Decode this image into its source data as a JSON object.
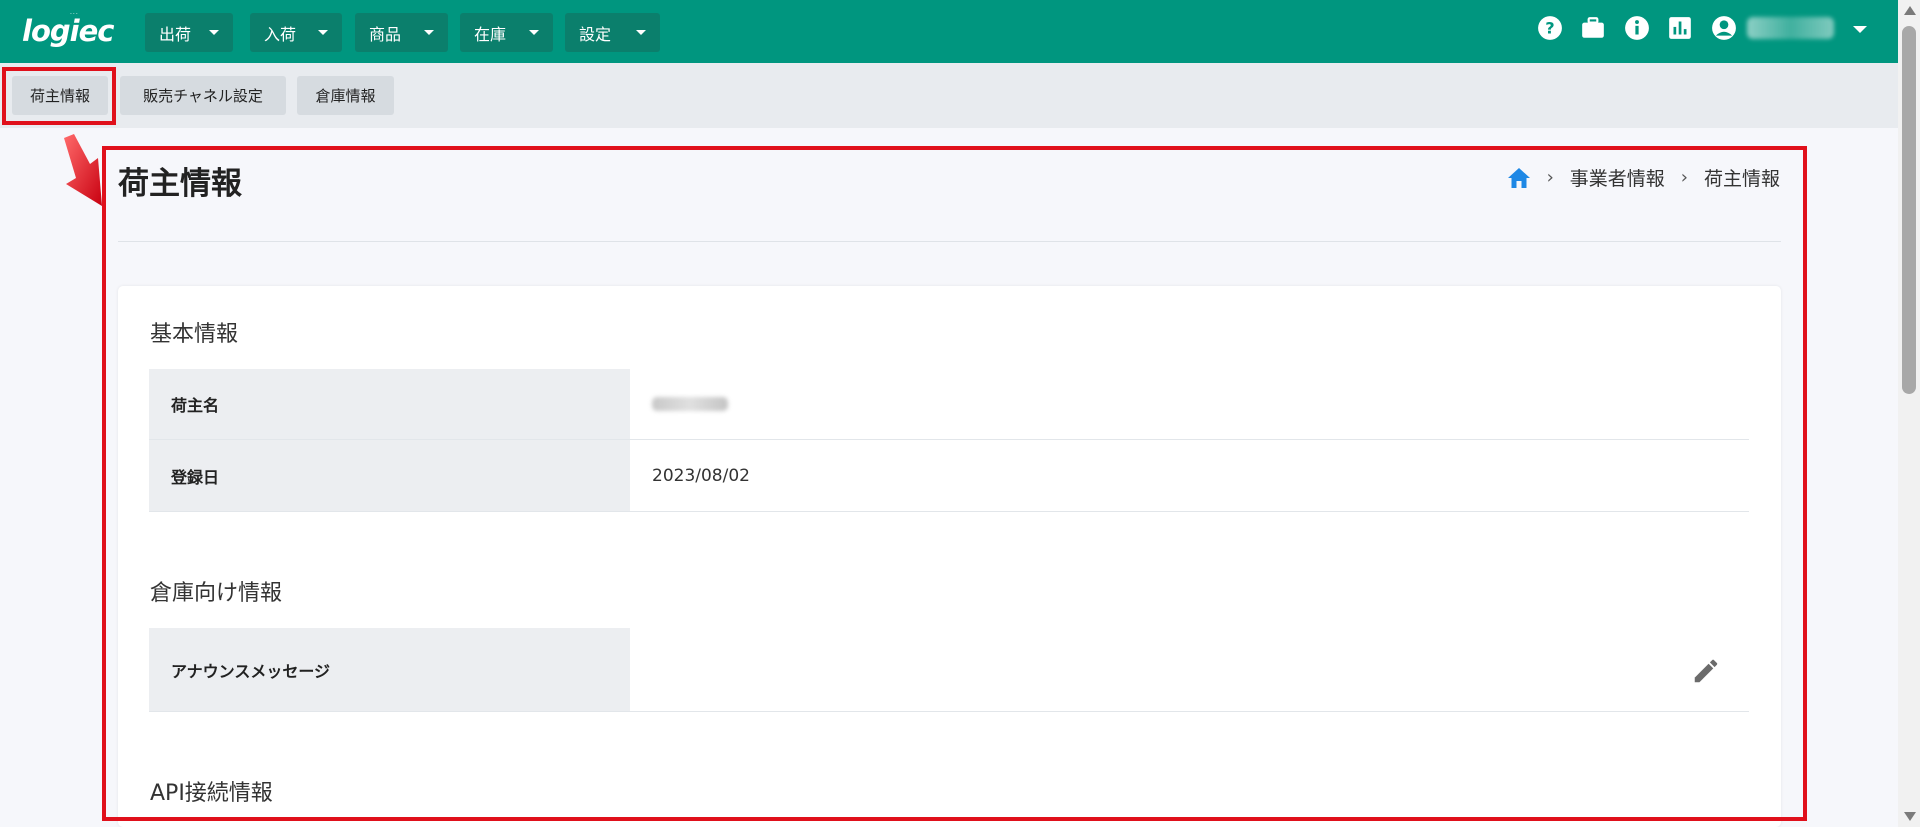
{
  "app": {
    "logo": "logiec"
  },
  "topnav": {
    "menus": [
      {
        "label": "出荷"
      },
      {
        "label": "入荷"
      },
      {
        "label": "商品"
      },
      {
        "label": "在庫"
      },
      {
        "label": "設定"
      }
    ],
    "icons": [
      "help-icon",
      "briefcase-icon",
      "info-icon",
      "bar-chart-icon",
      "account-icon"
    ]
  },
  "subnav": {
    "tabs": [
      {
        "label": "荷主情報"
      },
      {
        "label": "販売チャネル設定"
      },
      {
        "label": "倉庫情報"
      }
    ]
  },
  "page": {
    "title": "荷主情報",
    "breadcrumb": [
      "事業者情報",
      "荷主情報"
    ]
  },
  "basic_info": {
    "title": "基本情報",
    "rows": [
      {
        "label": "荷主名",
        "value": ""
      },
      {
        "label": "登録日",
        "value": "2023/08/02"
      }
    ]
  },
  "warehouse_info": {
    "title": "倉庫向け情報",
    "rows": [
      {
        "label": "アナウンスメッセージ",
        "value": ""
      }
    ]
  },
  "api_info": {
    "title": "API接続情報"
  },
  "colors": {
    "header": "#00967f",
    "highlight": "#e0101b",
    "home_icon": "#1e88e5"
  }
}
